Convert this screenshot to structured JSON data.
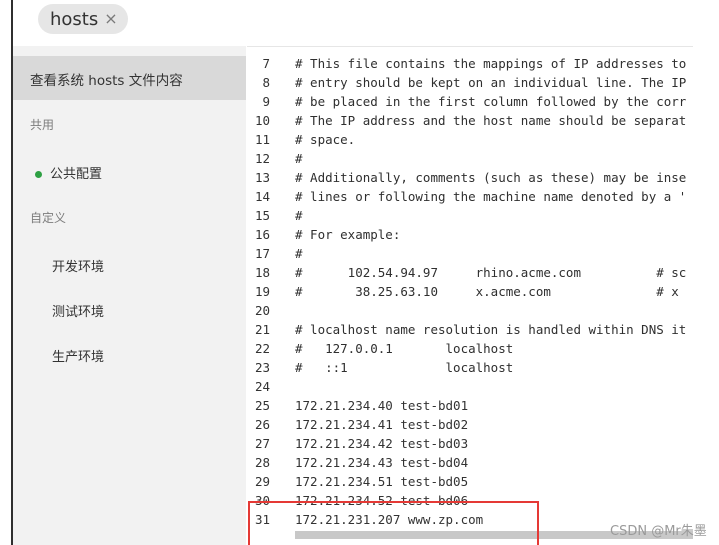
{
  "tab": {
    "label": "hosts",
    "close_glyph": "×"
  },
  "sidebar": {
    "selected": "查看系统 hosts 文件内容",
    "section_shared": "共用",
    "shared_item": "公共配置",
    "section_custom": "自定义",
    "custom_items": [
      "开发环境",
      "测试环境",
      "生产环境"
    ]
  },
  "editor": {
    "lines": [
      {
        "n": "7",
        "text": "# This file contains the mappings of IP addresses to"
      },
      {
        "n": "8",
        "text": "# entry should be kept on an individual line. The IP"
      },
      {
        "n": "9",
        "text": "# be placed in the first column followed by the corr"
      },
      {
        "n": "10",
        "text": "# The IP address and the host name should be separat"
      },
      {
        "n": "11",
        "text": "# space."
      },
      {
        "n": "12",
        "text": "#"
      },
      {
        "n": "13",
        "text": "# Additionally, comments (such as these) may be inse"
      },
      {
        "n": "14",
        "text": "# lines or following the machine name denoted by a '"
      },
      {
        "n": "15",
        "text": "#"
      },
      {
        "n": "16",
        "text": "# For example:"
      },
      {
        "n": "17",
        "text": "#"
      },
      {
        "n": "18",
        "text": "#      102.54.94.97     rhino.acme.com          # sc"
      },
      {
        "n": "19",
        "text": "#       38.25.63.10     x.acme.com              # x"
      },
      {
        "n": "20",
        "text": ""
      },
      {
        "n": "21",
        "text": "# localhost name resolution is handled within DNS it"
      },
      {
        "n": "22",
        "text": "#   127.0.0.1       localhost"
      },
      {
        "n": "23",
        "text": "#   ::1             localhost"
      },
      {
        "n": "24",
        "text": ""
      },
      {
        "n": "25",
        "text": "172.21.234.40 test-bd01"
      },
      {
        "n": "26",
        "text": "172.21.234.41 test-bd02"
      },
      {
        "n": "27",
        "text": "172.21.234.42 test-bd03"
      },
      {
        "n": "28",
        "text": "172.21.234.43 test-bd04"
      },
      {
        "n": "29",
        "text": "172.21.234.51 test-bd05"
      },
      {
        "n": "30",
        "text": "172.21.234.52 test-bd06"
      },
      {
        "n": "31",
        "text": "172.21.231.207 www.zp.com"
      }
    ]
  },
  "watermark": "CSDN @Mr朱墨",
  "colors": {
    "highlight_border": "#e53935",
    "status_dot": "#2ea043"
  }
}
